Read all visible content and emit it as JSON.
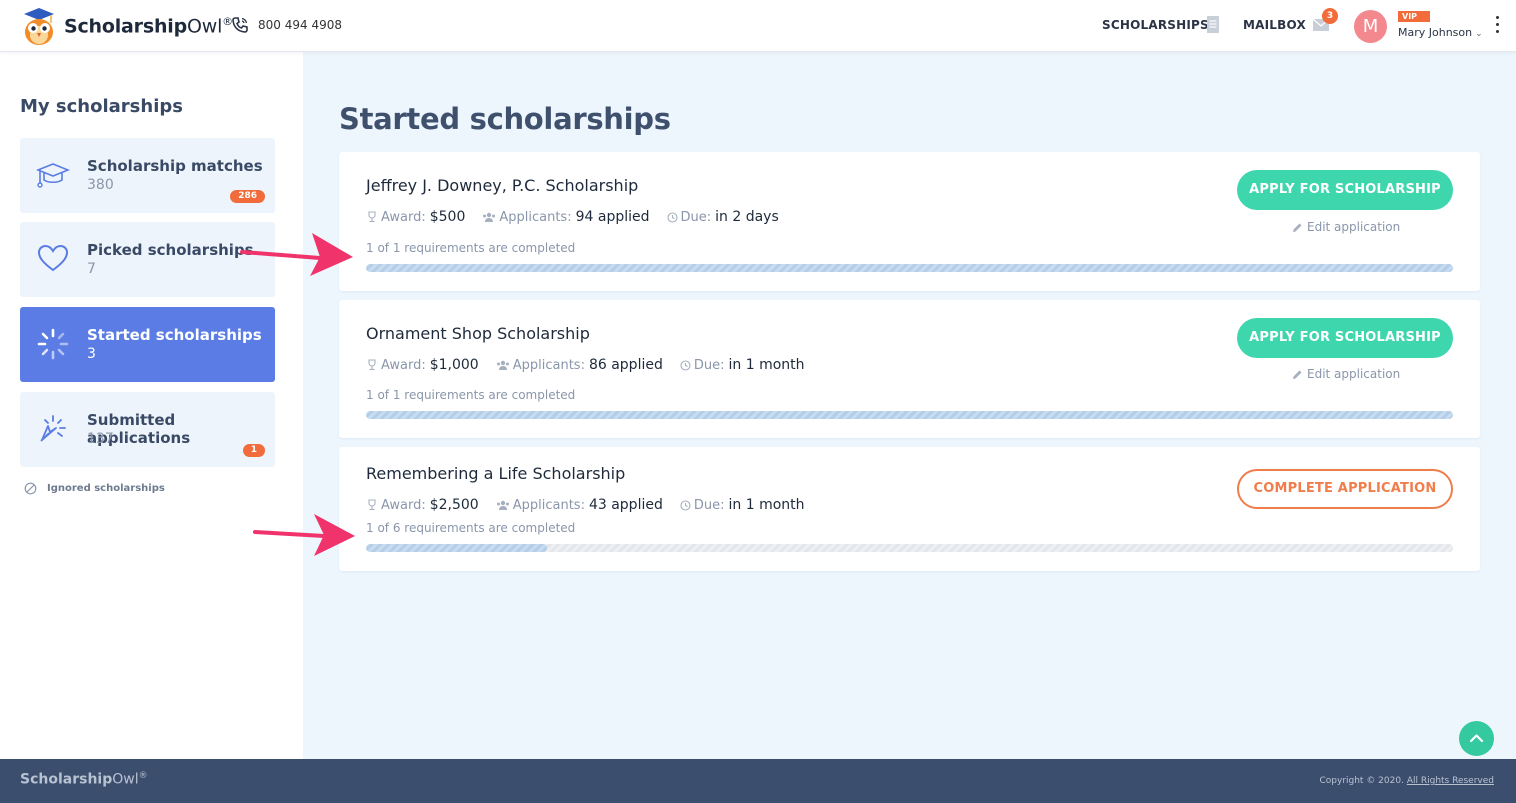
{
  "header": {
    "brand_bold": "Scholarship",
    "brand_light": "Owl",
    "brand_reg": "®",
    "phone": "800 494 4908",
    "nav_scholarships": "SCHOLARSHIPS",
    "nav_mailbox": "MAILBOX",
    "mail_count": "3",
    "avatar_initial": "M",
    "vip": "VIP",
    "user_name": "Mary Johnson"
  },
  "sidebar": {
    "title": "My scholarships",
    "items": [
      {
        "label": "Scholarship matches",
        "count": "380",
        "badge": "286",
        "icon": "graduation-cap-icon"
      },
      {
        "label": "Picked scholarships",
        "count": "7",
        "badge": "",
        "icon": "heart-icon"
      },
      {
        "label": "Started scholarships",
        "count": "3",
        "badge": "",
        "icon": "spinner-icon"
      },
      {
        "label": "Submitted applications",
        "count": "137",
        "badge": "1",
        "icon": "cursor-click-icon"
      }
    ],
    "ignored": "Ignored scholarships"
  },
  "main": {
    "title": "Started scholarships",
    "cards": [
      {
        "name": "Jeffrey J. Downey, P.C. Scholarship",
        "award_label": "Award:",
        "award": "$500",
        "applicants_label": "Applicants:",
        "applicants": "94 applied",
        "due_label": "Due:",
        "due": "in 2 days",
        "requirements": "1 of 1 requirements are completed",
        "progress": 1.0,
        "button": "APPLY FOR SCHOLARSHIP",
        "edit": "Edit application"
      },
      {
        "name": "Ornament Shop Scholarship",
        "award_label": "Award:",
        "award": "$1,000",
        "applicants_label": "Applicants:",
        "applicants": "86 applied",
        "due_label": "Due:",
        "due": "in 1 month",
        "requirements": "1 of 1 requirements are completed",
        "progress": 1.0,
        "button": "APPLY FOR SCHOLARSHIP",
        "edit": "Edit application"
      },
      {
        "name": "Remembering a Life Scholarship",
        "award_label": "Award:",
        "award": "$2,500",
        "applicants_label": "Applicants:",
        "applicants": "43 applied",
        "due_label": "Due:",
        "due": "in 1 month",
        "requirements": "1 of 6 requirements are completed",
        "progress": 0.1667,
        "button": "COMPLETE APPLICATION"
      }
    ]
  },
  "footer": {
    "brand_bold": "Scholarship",
    "brand_light": "Owl",
    "brand_reg": "®",
    "copyright": "Copyright © 2020.",
    "rights": "All Rights Reserved"
  },
  "colors": {
    "accent_green": "#3dd6ad",
    "accent_orange": "#f26b3a",
    "active_blue": "#5a7ce4",
    "due_red": "#e8384f",
    "arrow_pink": "#f0336a"
  }
}
